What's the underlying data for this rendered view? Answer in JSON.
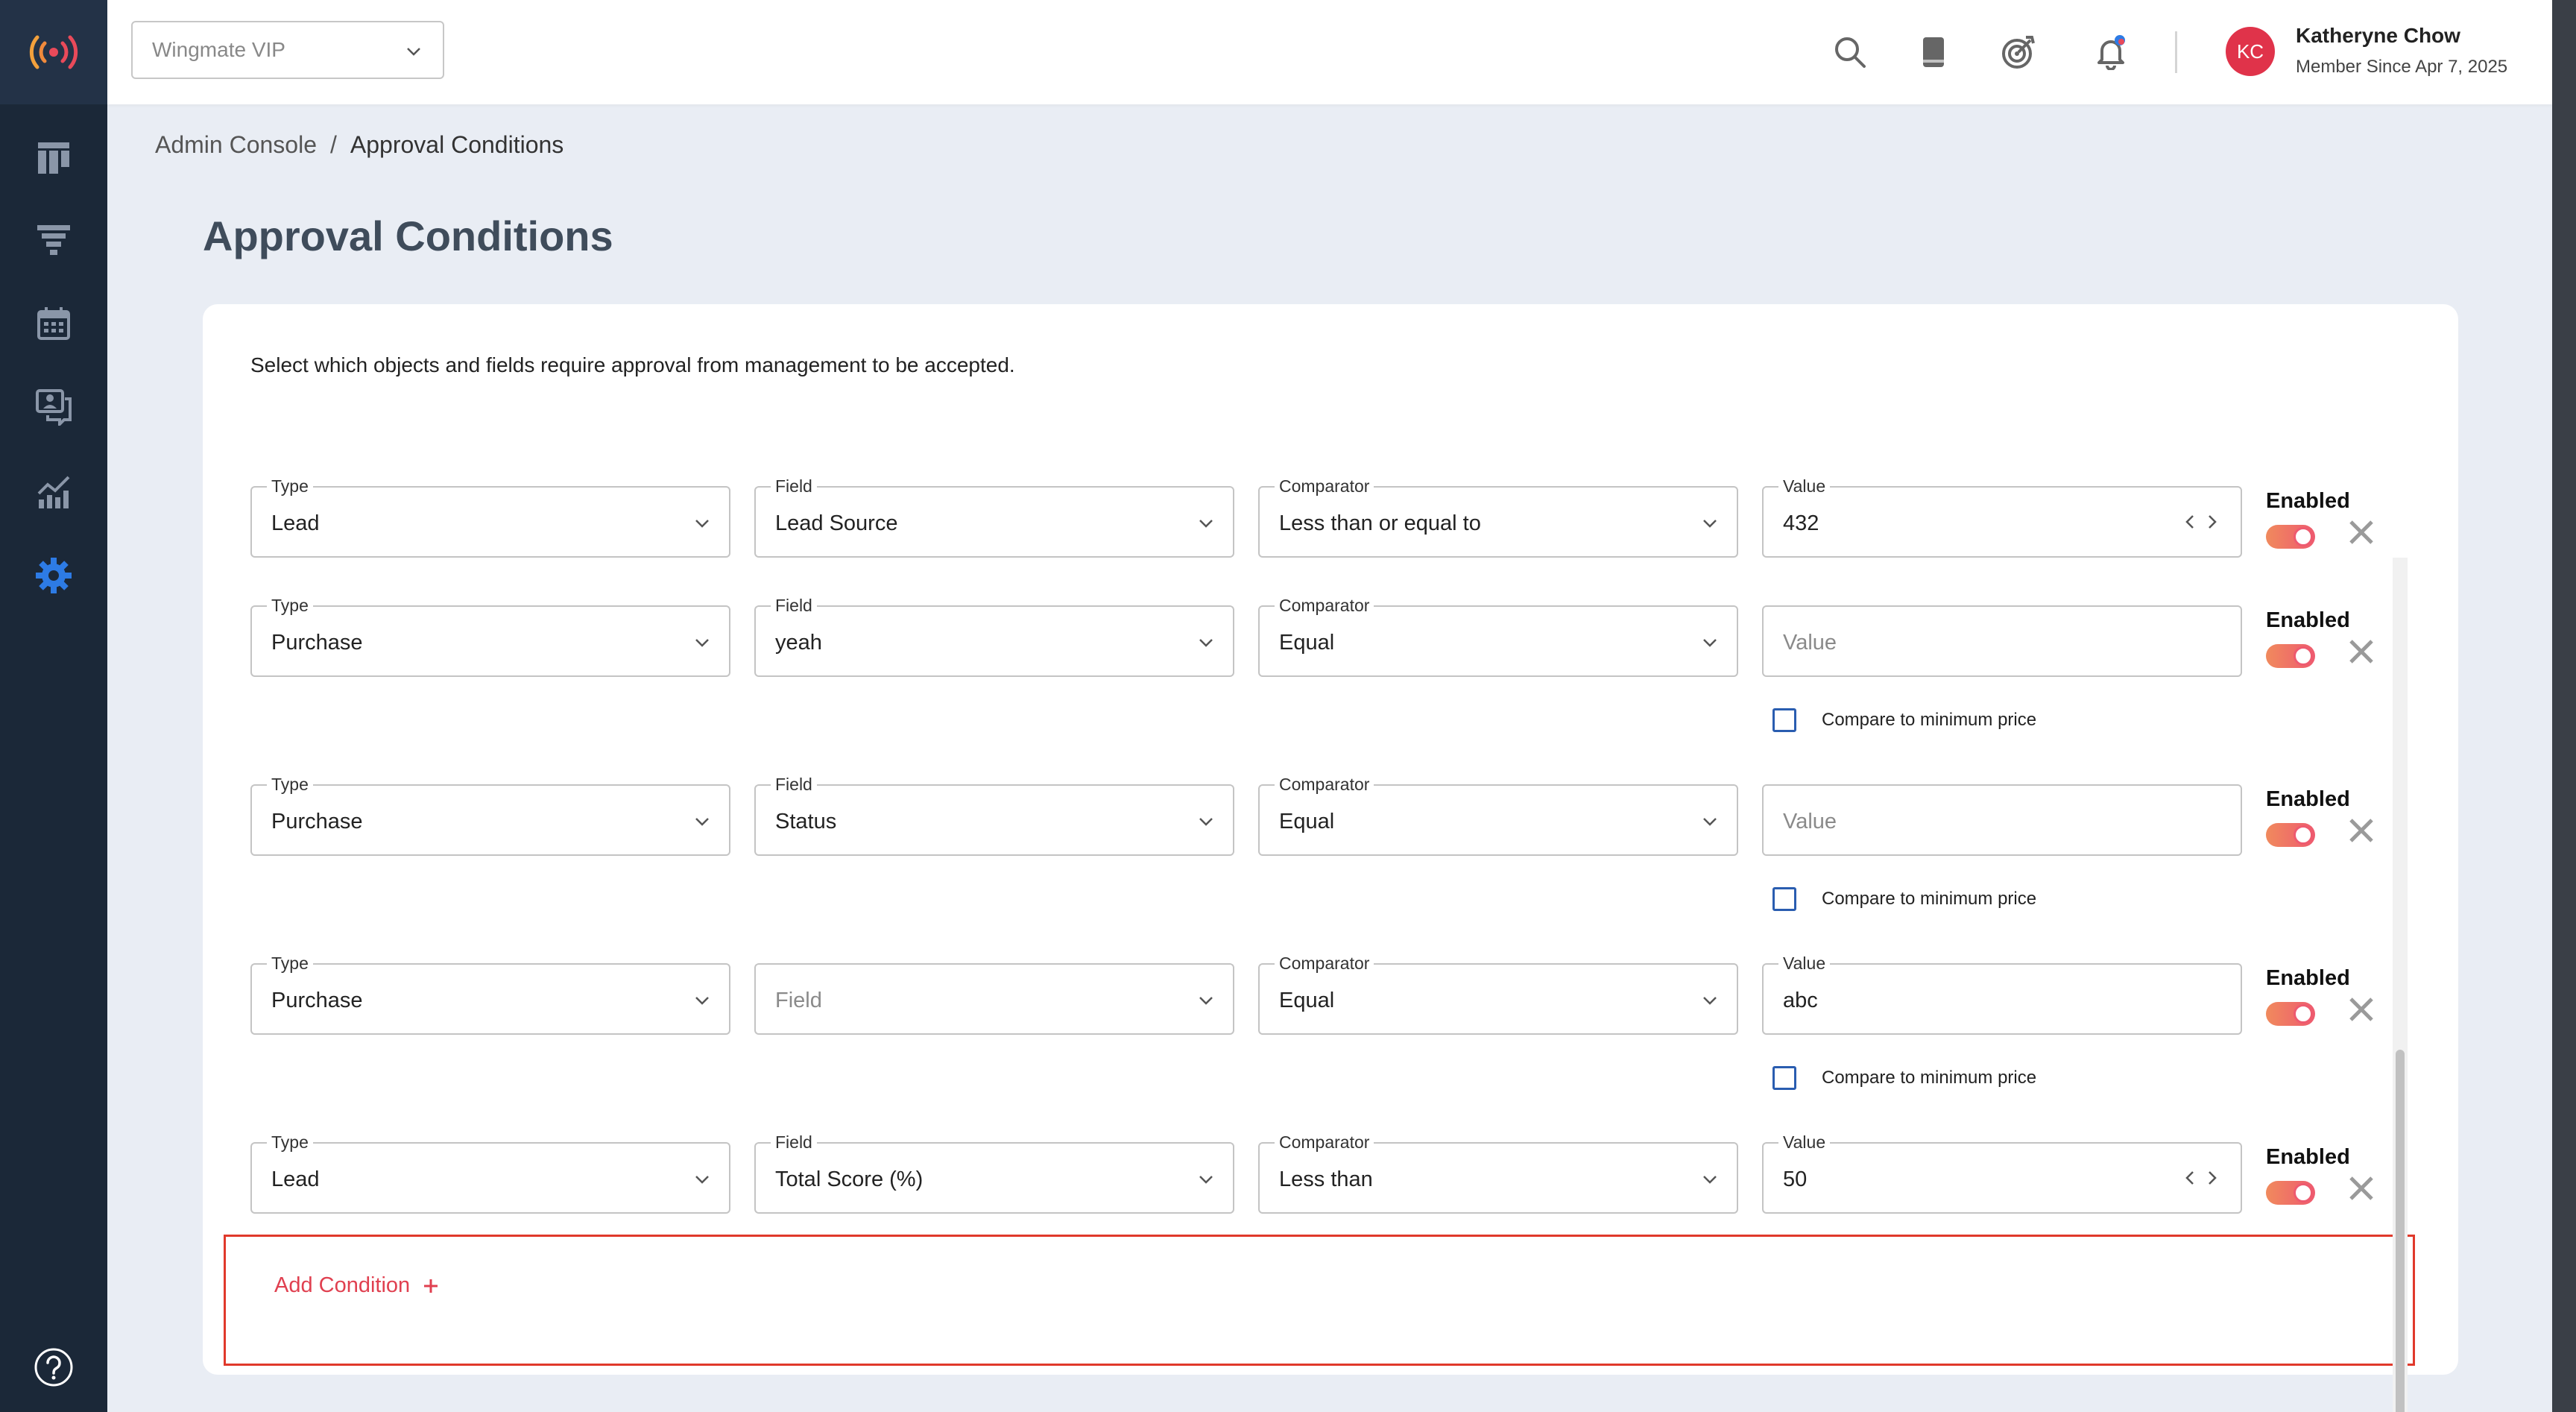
{
  "org_select": {
    "value": "Wingmate VIP"
  },
  "user": {
    "initials": "KC",
    "name": "Katheryne Chow",
    "since": "Member Since Apr 7, 2025"
  },
  "breadcrumb": {
    "parent": "Admin Console",
    "separator": "/",
    "current": "Approval Conditions"
  },
  "page": {
    "title": "Approval Conditions",
    "description": "Select which objects and fields require approval from management to be accepted."
  },
  "labels": {
    "type": "Type",
    "field": "Field",
    "comparator": "Comparator",
    "value": "Value",
    "enabled": "Enabled",
    "compare_min_price": "Compare to minimum price",
    "add_condition": "Add Condition"
  },
  "placeholders": {
    "field": "Field",
    "value": "Value"
  },
  "conditions": [
    {
      "type": "Lead",
      "field": "Lead Source",
      "comparator": "Less than or equal to",
      "value": "432",
      "enabled": true
    },
    {
      "type": "Purchase",
      "field": "yeah",
      "comparator": "Equal",
      "value": "",
      "enabled": true,
      "compare_min_price": false
    },
    {
      "type": "Purchase",
      "field": "Status",
      "comparator": "Equal",
      "value": "",
      "enabled": true,
      "compare_min_price": false
    },
    {
      "type": "Purchase",
      "field": "",
      "comparator": "Equal",
      "value": "abc",
      "enabled": true,
      "compare_min_price": false
    },
    {
      "type": "Lead",
      "field": "Total Score (%)",
      "comparator": "Less than",
      "value": "50",
      "enabled": true
    }
  ],
  "colors": {
    "accent": "#e04050",
    "sidebar": "#1b2838",
    "active_nav": "#2d7be5",
    "checkbox": "#2a5db0",
    "highlight": "#e0392b"
  },
  "icons": {
    "sidebar": [
      "logo-icon",
      "board-icon",
      "funnel-icon",
      "calendar-icon",
      "chat-icon",
      "analytics-icon",
      "gear-icon",
      "help-icon"
    ],
    "topbar": [
      "search-icon",
      "book-icon",
      "target-icon",
      "bell-icon"
    ]
  }
}
